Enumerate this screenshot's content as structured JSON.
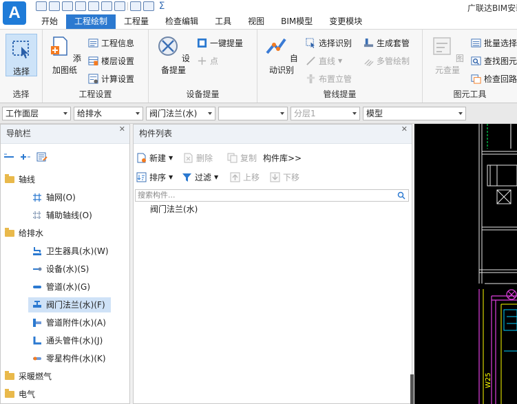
{
  "app": {
    "logo_letter": "A",
    "title": "广联达BIM安装计量"
  },
  "qat": {
    "sigma": "Σ"
  },
  "tabs": [
    {
      "label": "开始"
    },
    {
      "label": "工程绘制"
    },
    {
      "label": "工程量"
    },
    {
      "label": "检查编辑"
    },
    {
      "label": "工具"
    },
    {
      "label": "视图"
    },
    {
      "label": "BIM模型"
    },
    {
      "label": "变更模块"
    }
  ],
  "ribbon": {
    "select_group": {
      "label": "选择",
      "select_btn": "选择"
    },
    "project_group": {
      "label": "工程设置",
      "add_drawing": "添加图纸",
      "project_info": "工程信息",
      "floor_settings": "楼层设置",
      "calc_settings": "计算设置"
    },
    "equip_group": {
      "label": "设备提量",
      "equip_takeoff": "设备提量",
      "one_click": "一键提量",
      "point": "点"
    },
    "pipe_group": {
      "label": "管线提量",
      "auto_identify": "自动识别",
      "select_identify": "选择识别",
      "line": "直线",
      "arrange_riser": "布置立管",
      "gen_sleeve": "生成套管",
      "multi_pipe": "多管绘制"
    },
    "elem_group": {
      "label": "图元工具",
      "elem_check": "图元查量",
      "batch_select": "批量选择",
      "find_elem": "查找图元",
      "check_loop": "检查回路"
    }
  },
  "combos": [
    {
      "value": "工作面层"
    },
    {
      "value": "给排水"
    },
    {
      "value": "阀门法兰(水)"
    },
    {
      "value": ""
    },
    {
      "value": "分层1"
    },
    {
      "value": "模型"
    }
  ],
  "nav": {
    "title": "导航栏",
    "items": [
      {
        "label": "轴线"
      },
      {
        "label": "轴网(O)"
      },
      {
        "label": "辅助轴线(O)"
      },
      {
        "label": "给排水"
      },
      {
        "label": "卫生器具(水)(W)"
      },
      {
        "label": "设备(水)(S)"
      },
      {
        "label": "管道(水)(G)"
      },
      {
        "label": "阀门法兰(水)(F)"
      },
      {
        "label": "管道附件(水)(A)"
      },
      {
        "label": "通头管件(水)(J)"
      },
      {
        "label": "零星构件(水)(K)"
      },
      {
        "label": "采暖燃气"
      },
      {
        "label": "电气"
      }
    ]
  },
  "component_list": {
    "title": "构件列表",
    "new_btn": "新建",
    "delete_btn": "删除",
    "copy_btn": "复制",
    "library_btn": "构件库>>",
    "sort_btn": "排序",
    "filter_btn": "过滤",
    "move_up_btn": "上移",
    "move_down_btn": "下移",
    "search_placeholder": "搜索构件...",
    "items": [
      {
        "label": "阀门法兰(水)"
      }
    ]
  },
  "canvas": {
    "label_bottom": "W25"
  },
  "colors": {
    "accent": "#2b79d0",
    "selection": "#cfe2f7",
    "canvas_bg": "#000000"
  }
}
